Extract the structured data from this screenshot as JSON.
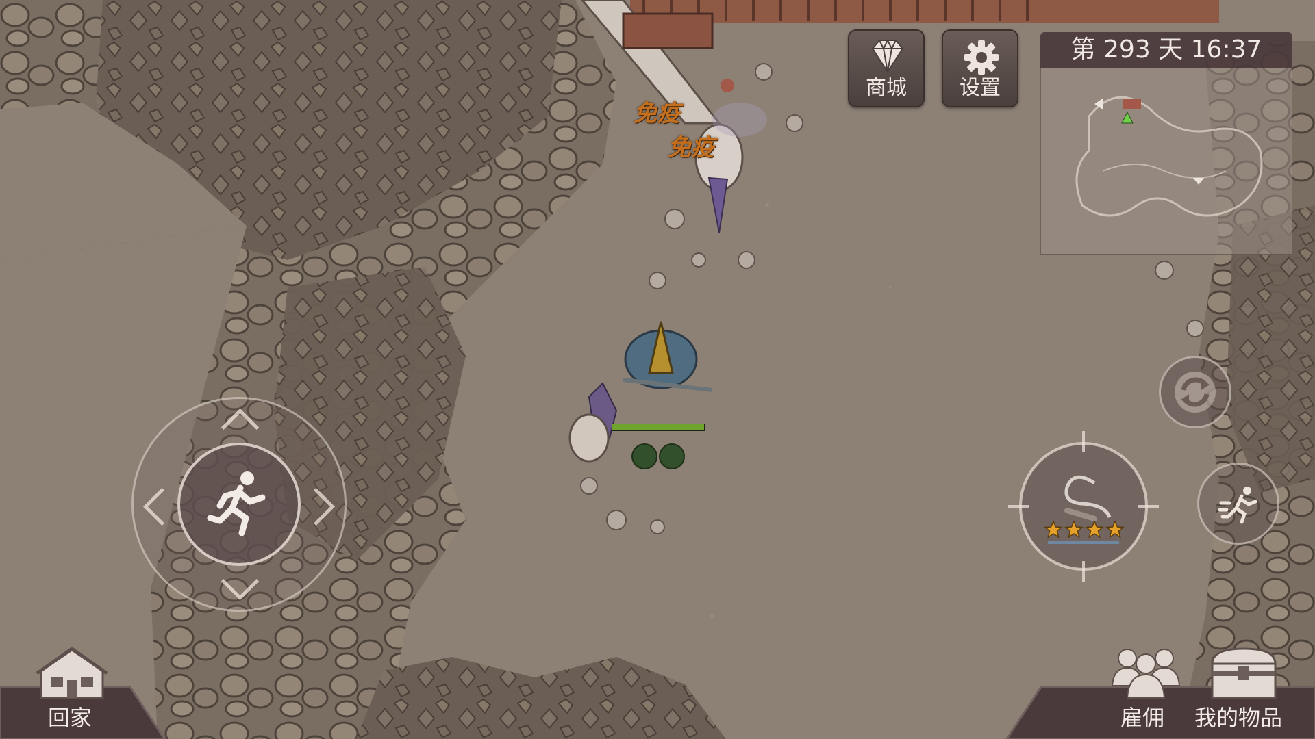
{
  "hud": {
    "shop_label": "商城",
    "settings_label": "设置",
    "day_time": "第 293 天  16:37"
  },
  "world": {
    "status_text_1": "免疫",
    "status_text_2": "免疫"
  },
  "weapon": {
    "stars": 4,
    "icon": "whip-icon"
  },
  "bottom_bar": {
    "home_label": "回家",
    "hire_label": "雇佣",
    "items_label": "我的物品"
  },
  "icons": {
    "shop": "diamond-icon",
    "settings": "gear-icon",
    "home": "house-icon",
    "hire": "people-icon",
    "items": "chest-icon",
    "move": "running-man-icon",
    "sprint": "dash-icon",
    "swap": "refresh-icon"
  },
  "colors": {
    "hud_panel": "#4b3a3c",
    "status_text": "#c46f1d",
    "health_bar": "#6fa52e",
    "star": "#e6a12a"
  }
}
